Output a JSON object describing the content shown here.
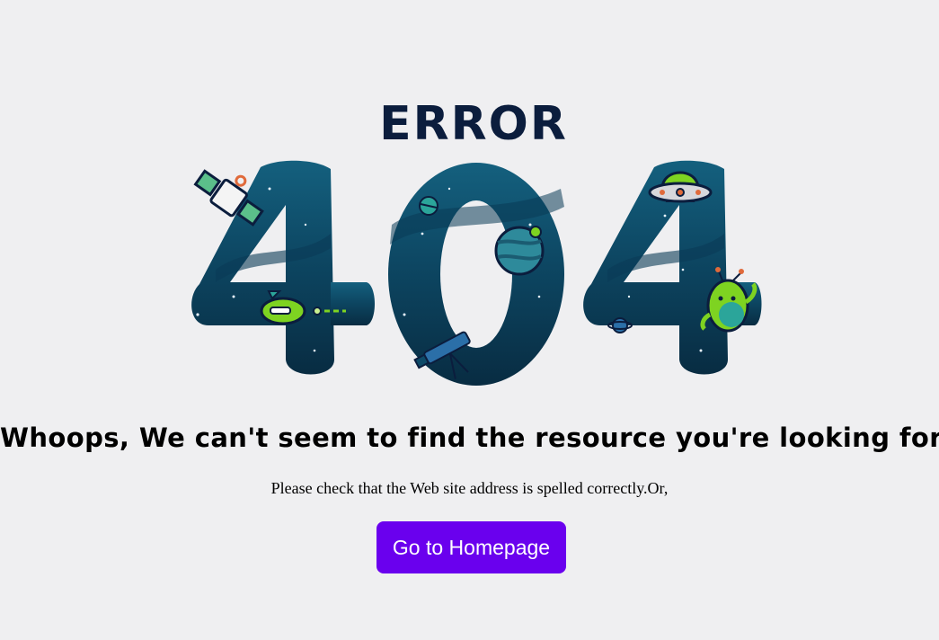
{
  "illustration": {
    "error_label": "ERROR",
    "code_digits": [
      "4",
      "0",
      "4"
    ],
    "colors": {
      "error_text": "#0b1d3d",
      "digit_dark": "#0a3148",
      "digit_mid": "#0e4a68",
      "digit_light": "#13607f",
      "accent_green": "#7ed321",
      "accent_teal": "#2ba59a"
    },
    "icons": [
      "satellite-icon",
      "rocket-icon",
      "ufo-icon",
      "planet-icon",
      "telescope-icon",
      "alien-icon"
    ]
  },
  "message": {
    "headline": "Whoops, We can't seem to find the resource you're looking for.",
    "subtext": "Please check that the Web site address is spelled correctly.Or,"
  },
  "actions": {
    "home_label": "Go to Homepage",
    "home_color": "#6a00ee"
  }
}
